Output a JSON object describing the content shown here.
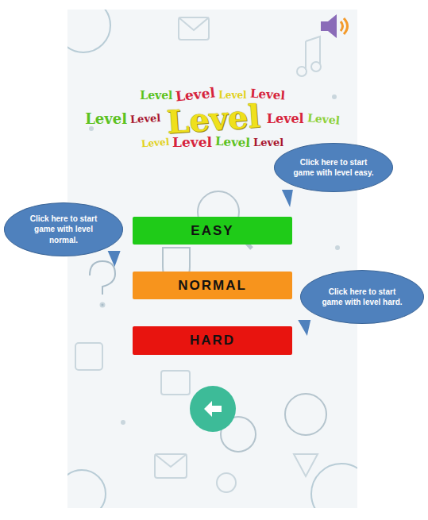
{
  "logo": {
    "title": "Level",
    "cloud": [
      {
        "text": "Level",
        "color": "#5cc21f"
      },
      {
        "text": "Level",
        "color": "#d6233c"
      },
      {
        "text": "Level",
        "color": "#e2d21e"
      },
      {
        "text": "Level",
        "color": "#d6233c"
      },
      {
        "text": "Level",
        "color": "#5cc21f"
      },
      {
        "text": "Level",
        "color": "#a81630"
      },
      {
        "text": "Level",
        "color": "#d6233c"
      },
      {
        "text": "Level",
        "color": "#8ed13a"
      },
      {
        "text": "Level",
        "color": "#e2d21e"
      },
      {
        "text": "Level",
        "color": "#d6233c"
      },
      {
        "text": "Level",
        "color": "#5cc21f"
      },
      {
        "text": "Level",
        "color": "#a81630"
      }
    ]
  },
  "levels": [
    {
      "label": "EASY",
      "color": "#1fcb18"
    },
    {
      "label": "NORMAL",
      "color": "#f7941d"
    },
    {
      "label": "HARD",
      "color": "#e8140f"
    }
  ],
  "callouts": [
    {
      "text": "Click here to start game with level easy."
    },
    {
      "text": "Click here to start game with level normal."
    },
    {
      "text": "Click here to start game with level hard."
    }
  ]
}
